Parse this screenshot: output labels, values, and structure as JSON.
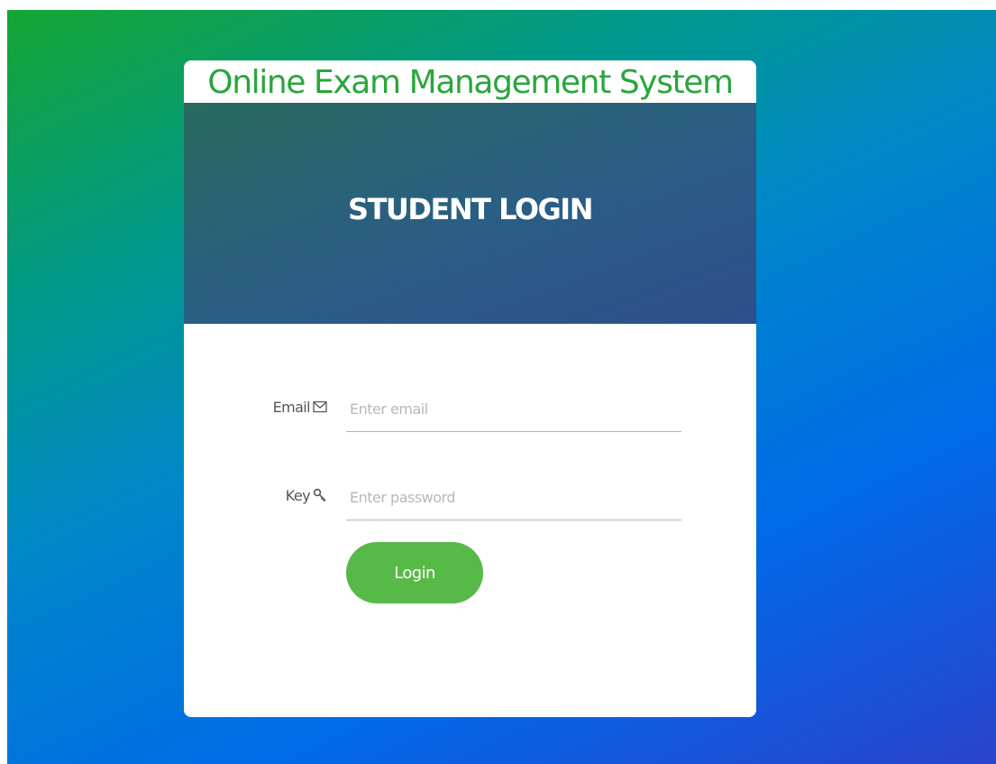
{
  "header": {
    "app_title": "Online Exam Management System"
  },
  "banner": {
    "title": "STUDENT LOGIN"
  },
  "form": {
    "email": {
      "label": "Email",
      "icon": "envelope-icon",
      "value": "",
      "placeholder": "Enter email"
    },
    "password": {
      "label": "Key",
      "icon": "key-icon",
      "value": "",
      "placeholder": "Enter password"
    },
    "login_label": "Login"
  },
  "colors": {
    "title_green": "#2aa63c",
    "button_green": "#57b947",
    "banner_dark": "#2a5d86"
  }
}
